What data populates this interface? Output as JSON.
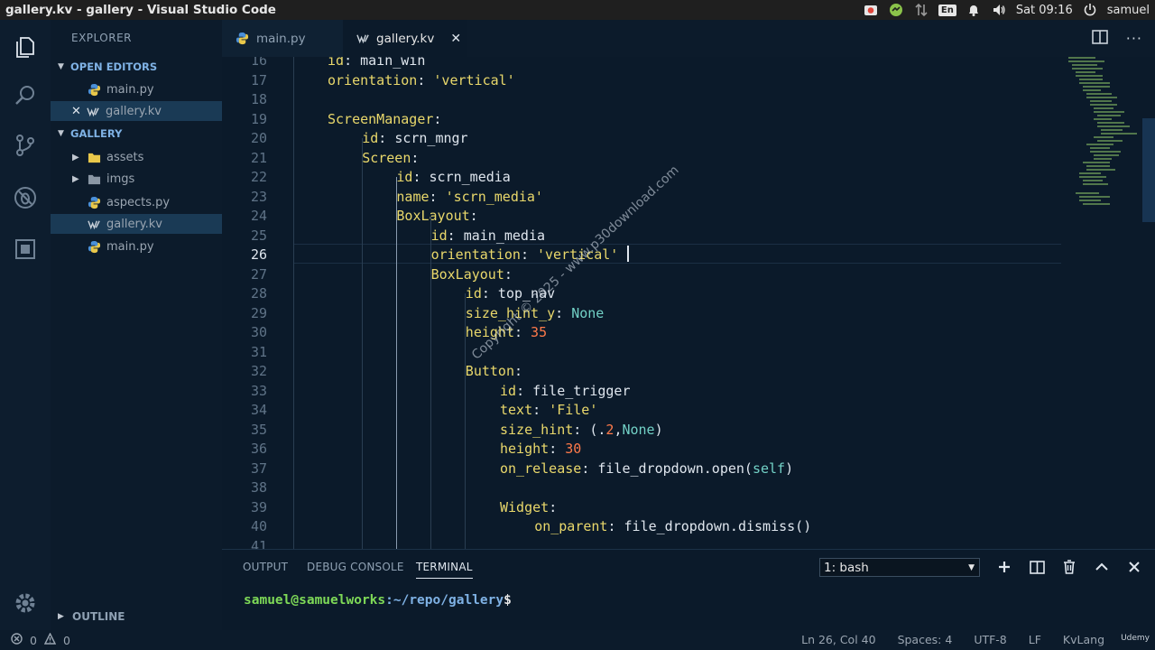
{
  "window": {
    "title": "gallery.kv - gallery - Visual Studio Code"
  },
  "system_tray": {
    "language": "En",
    "clock": "Sat 09:16",
    "user": "samuel"
  },
  "sidebar": {
    "title": "EXPLORER",
    "open_editors_label": "OPEN EDITORS",
    "open_editors": [
      {
        "label": "main.py",
        "icon": "python-file-icon"
      },
      {
        "label": "gallery.kv",
        "icon": "kv-file-icon"
      }
    ],
    "folder_label": "GALLERY",
    "files": [
      {
        "label": "assets",
        "icon": "folder-icon"
      },
      {
        "label": "imgs",
        "icon": "folder-icon"
      },
      {
        "label": "aspects.py",
        "icon": "python-file-icon"
      },
      {
        "label": "gallery.kv",
        "icon": "kv-file-icon"
      },
      {
        "label": "main.py",
        "icon": "python-file-icon"
      }
    ],
    "outline_label": "OUTLINE"
  },
  "tabs": [
    {
      "label": "main.py",
      "active": false
    },
    {
      "label": "gallery.kv",
      "active": true
    }
  ],
  "editor": {
    "current_line": 26,
    "lines": [
      {
        "n": "16",
        "indent": 1,
        "tokens": [
          [
            "k",
            "id"
          ],
          [
            "p",
            ": "
          ],
          [
            "v",
            "main_win"
          ]
        ]
      },
      {
        "n": "17",
        "indent": 1,
        "tokens": [
          [
            "k",
            "orientation"
          ],
          [
            "p",
            ": "
          ],
          [
            "s",
            "'vertical'"
          ]
        ]
      },
      {
        "n": "18",
        "indent": 0,
        "tokens": []
      },
      {
        "n": "19",
        "indent": 1,
        "tokens": [
          [
            "k",
            "ScreenManager"
          ],
          [
            "p",
            ":"
          ]
        ]
      },
      {
        "n": "20",
        "indent": 2,
        "tokens": [
          [
            "k",
            "id"
          ],
          [
            "p",
            ": "
          ],
          [
            "v",
            "scrn_mngr"
          ]
        ]
      },
      {
        "n": "21",
        "indent": 2,
        "tokens": [
          [
            "k",
            "Screen"
          ],
          [
            "p",
            ":"
          ]
        ]
      },
      {
        "n": "22",
        "indent": 3,
        "tokens": [
          [
            "k",
            "id"
          ],
          [
            "p",
            ": "
          ],
          [
            "v",
            "scrn_media"
          ]
        ]
      },
      {
        "n": "23",
        "indent": 3,
        "tokens": [
          [
            "k",
            "name"
          ],
          [
            "p",
            ": "
          ],
          [
            "s",
            "'scrn_media'"
          ]
        ]
      },
      {
        "n": "24",
        "indent": 3,
        "tokens": [
          [
            "k",
            "BoxLayout"
          ],
          [
            "p",
            ":"
          ]
        ]
      },
      {
        "n": "25",
        "indent": 4,
        "tokens": [
          [
            "k",
            "id"
          ],
          [
            "p",
            ": "
          ],
          [
            "v",
            "main_media"
          ]
        ]
      },
      {
        "n": "26",
        "indent": 4,
        "tokens": [
          [
            "k",
            "orientation"
          ],
          [
            "p",
            ": "
          ],
          [
            "s",
            "'vertical'"
          ]
        ]
      },
      {
        "n": "27",
        "indent": 4,
        "tokens": [
          [
            "k",
            "BoxLayout"
          ],
          [
            "p",
            ":"
          ]
        ]
      },
      {
        "n": "28",
        "indent": 5,
        "tokens": [
          [
            "k",
            "id"
          ],
          [
            "p",
            ": "
          ],
          [
            "v",
            "top_nav"
          ]
        ]
      },
      {
        "n": "29",
        "indent": 5,
        "tokens": [
          [
            "k",
            "size_hint_y"
          ],
          [
            "p",
            ": "
          ],
          [
            "c",
            "None"
          ]
        ]
      },
      {
        "n": "30",
        "indent": 5,
        "tokens": [
          [
            "k",
            "height"
          ],
          [
            "p",
            ": "
          ],
          [
            "n",
            "35"
          ]
        ]
      },
      {
        "n": "31",
        "indent": 0,
        "tokens": []
      },
      {
        "n": "32",
        "indent": 5,
        "tokens": [
          [
            "k",
            "Button"
          ],
          [
            "p",
            ":"
          ]
        ]
      },
      {
        "n": "33",
        "indent": 6,
        "tokens": [
          [
            "k",
            "id"
          ],
          [
            "p",
            ": "
          ],
          [
            "v",
            "file_trigger"
          ]
        ]
      },
      {
        "n": "34",
        "indent": 6,
        "tokens": [
          [
            "k",
            "text"
          ],
          [
            "p",
            ": "
          ],
          [
            "s",
            "'File'"
          ]
        ]
      },
      {
        "n": "35",
        "indent": 6,
        "tokens": [
          [
            "k",
            "size_hint"
          ],
          [
            "p",
            ": (."
          ],
          [
            "n",
            "2"
          ],
          [
            "p",
            ","
          ],
          [
            "c",
            "None"
          ],
          [
            "p",
            ")"
          ]
        ]
      },
      {
        "n": "36",
        "indent": 6,
        "tokens": [
          [
            "k",
            "height"
          ],
          [
            "p",
            ": "
          ],
          [
            "n",
            "30"
          ]
        ]
      },
      {
        "n": "37",
        "indent": 6,
        "tokens": [
          [
            "k",
            "on_release"
          ],
          [
            "p",
            ": "
          ],
          [
            "v",
            "file_dropdown.open("
          ],
          [
            "c",
            "self"
          ],
          [
            "v",
            ")"
          ]
        ]
      },
      {
        "n": "38",
        "indent": 0,
        "tokens": []
      },
      {
        "n": "39",
        "indent": 6,
        "tokens": [
          [
            "k",
            "Widget"
          ],
          [
            "p",
            ":"
          ]
        ]
      },
      {
        "n": "40",
        "indent": 7,
        "tokens": [
          [
            "k",
            "on_parent"
          ],
          [
            "p",
            ": "
          ],
          [
            "v",
            "file_dropdown.dismiss()"
          ]
        ]
      },
      {
        "n": "41",
        "indent": 0,
        "tokens": []
      }
    ]
  },
  "watermark": "Copyright © 2025 - www.p30download.com",
  "panel": {
    "tabs": [
      "OUTPUT",
      "DEBUG CONSOLE",
      "TERMINAL"
    ],
    "active_tab": "TERMINAL",
    "terminal_select": "1: bash",
    "prompt_user": "samuel@samuelworks",
    "prompt_path": ":~/repo/gallery",
    "prompt_dollar": "$"
  },
  "statusbar": {
    "errors": "0",
    "warnings": "0",
    "position": "Ln 26, Col 40",
    "spaces": "Spaces: 4",
    "encoding": "UTF-8",
    "eol": "LF",
    "language": "KvLang",
    "brand": "Udemy"
  }
}
